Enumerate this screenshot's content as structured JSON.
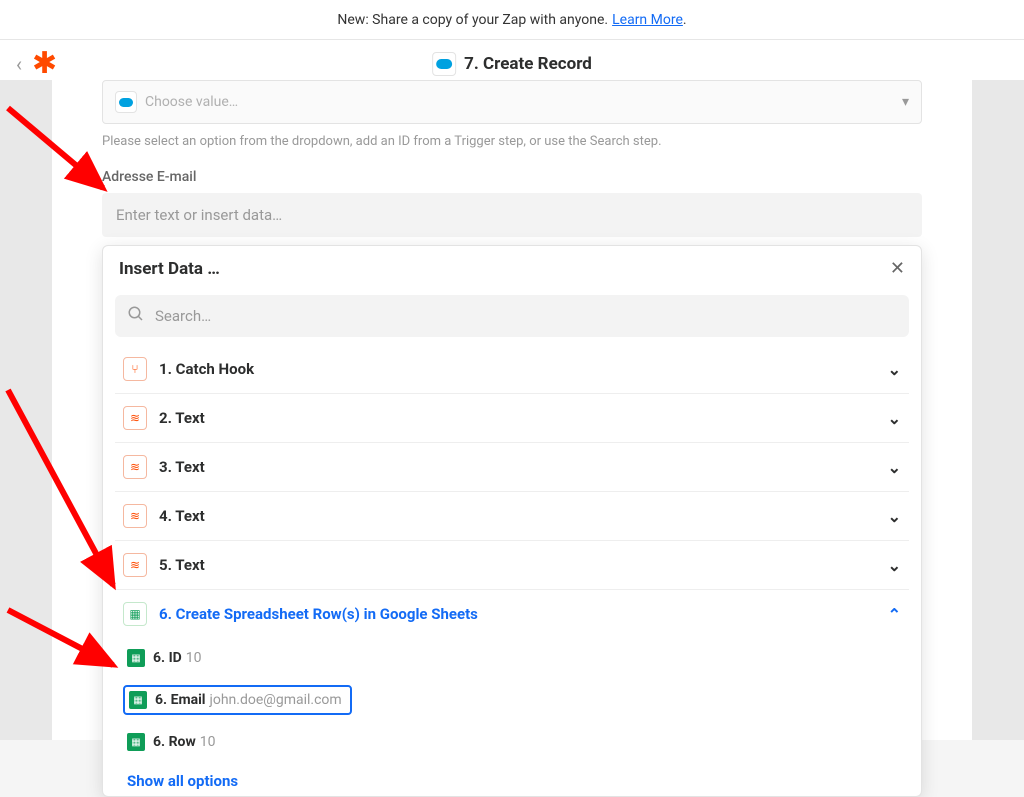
{
  "announcement": {
    "text": "New: Share a copy of your Zap with anyone.",
    "link_text": "Learn More",
    "period": "."
  },
  "header": {
    "title": "7. Create Record"
  },
  "dropdown": {
    "placeholder": "Choose value…"
  },
  "help_text": "Please select an option from the dropdown, add an ID from a Trigger step, or use the Search step.",
  "field_label": "Adresse E-mail",
  "text_input": {
    "placeholder": "Enter text or insert data…"
  },
  "popup": {
    "title": "Insert Data …",
    "search_placeholder": "Search…"
  },
  "steps": [
    {
      "label": "1. Catch Hook",
      "icon": "orange",
      "glyph": "⑂",
      "expanded": false
    },
    {
      "label": "2. Text",
      "icon": "orange",
      "glyph": "≋",
      "expanded": false
    },
    {
      "label": "3. Text",
      "icon": "orange",
      "glyph": "≋",
      "expanded": false
    },
    {
      "label": "4. Text",
      "icon": "orange",
      "glyph": "≋",
      "expanded": false
    },
    {
      "label": "5. Text",
      "icon": "orange",
      "glyph": "≋",
      "expanded": false
    },
    {
      "label": "6. Create Spreadsheet Row(s) in Google Sheets",
      "icon": "green",
      "glyph": "▦",
      "expanded": true,
      "active": true
    }
  ],
  "sub_items": [
    {
      "key": "6. ID",
      "val": "10",
      "selected": false
    },
    {
      "key": "6. Email",
      "val": "john.doe@gmail.com",
      "selected": true
    },
    {
      "key": "6. Row",
      "val": "10",
      "selected": false
    }
  ],
  "show_all": "Show all options"
}
